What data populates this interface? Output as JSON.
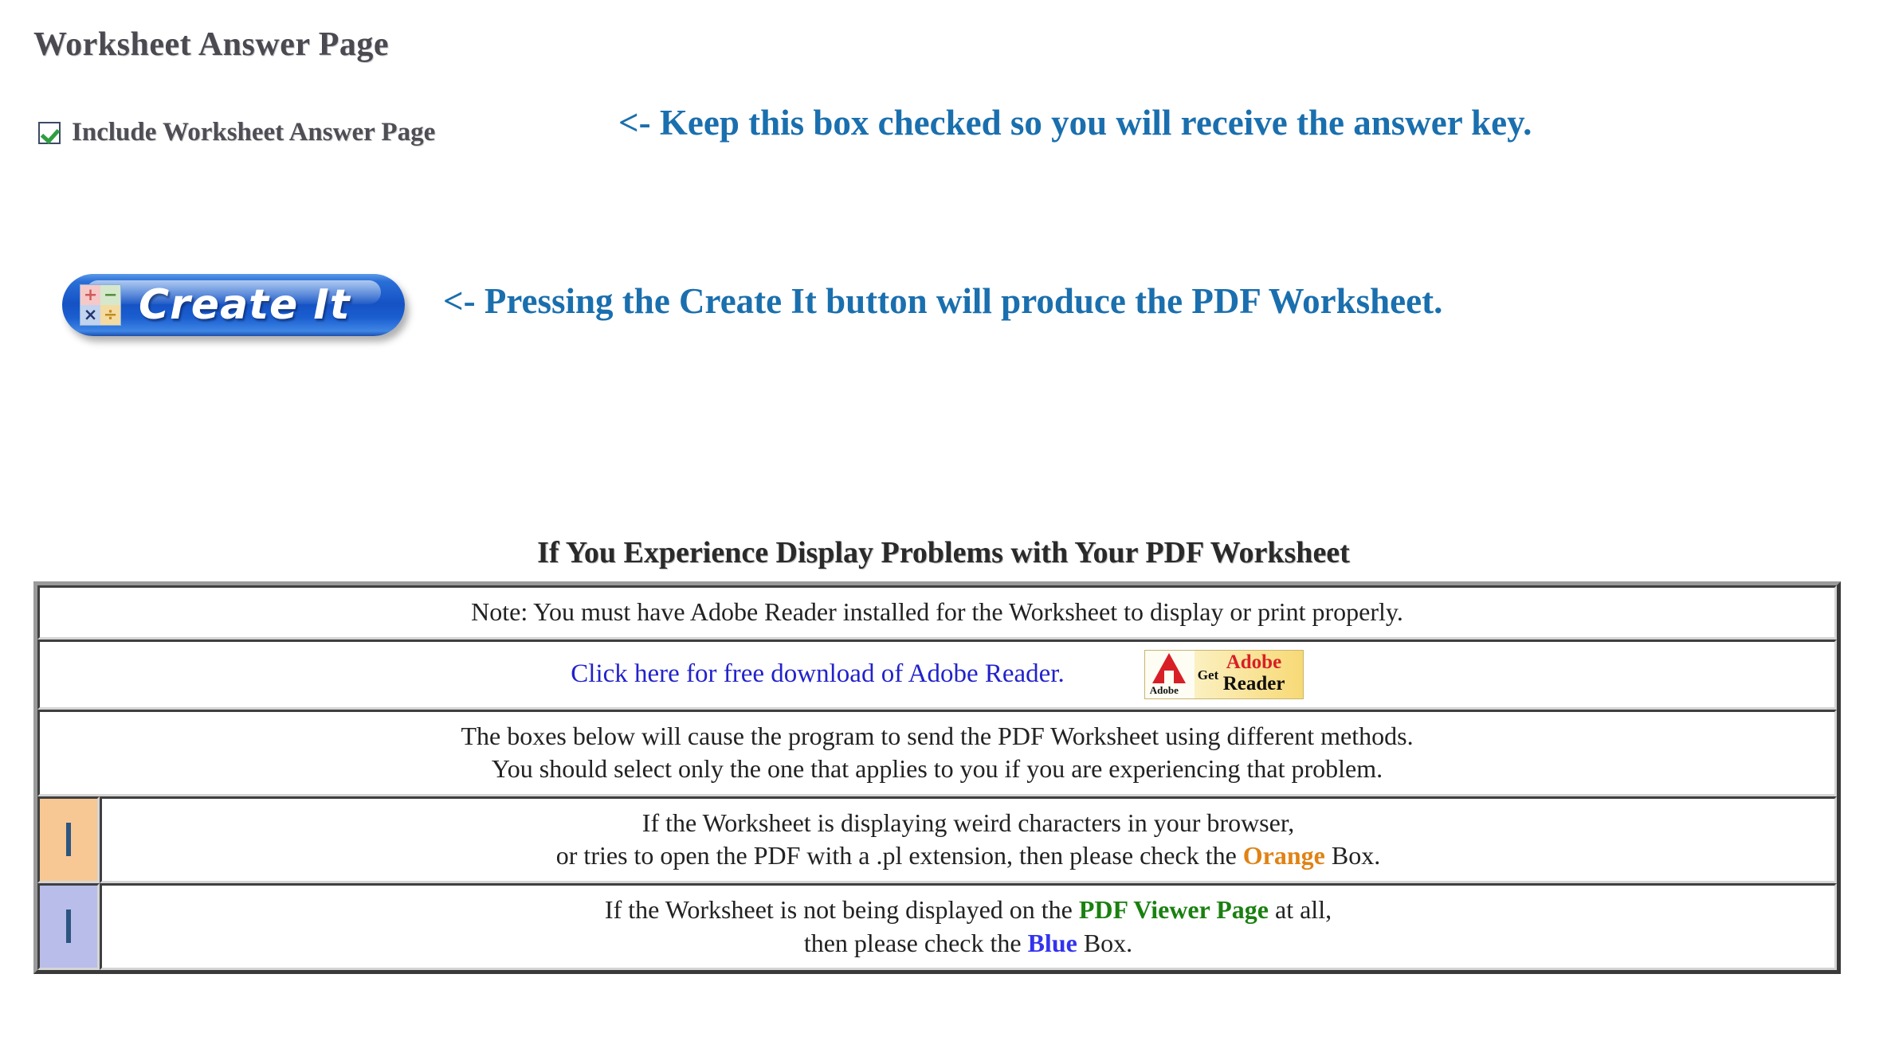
{
  "page": {
    "title": "Worksheet Answer Page"
  },
  "answer_option": {
    "label": "Include Worksheet Answer Page",
    "checked": true,
    "checkbox_icon": "checkbox-checked-icon"
  },
  "annotations": {
    "answer_note": "<- Keep this box checked so you will receive the answer key.",
    "create_note": "<- Pressing the Create It button will produce the PDF Worksheet."
  },
  "create_button": {
    "label": "Create It",
    "icon": "math-operations-icon",
    "icon_symbols": [
      "+",
      "−",
      "×",
      "÷"
    ]
  },
  "help_section": {
    "heading": "If You Experience Display Problems with Your PDF Worksheet",
    "rows": {
      "note": "Note: You must have Adobe Reader installed for the Worksheet to display or print properly.",
      "link_text": "Click here for free download of Adobe Reader.",
      "badge": {
        "get": "Get",
        "adobe": "Adobe",
        "reader": "Reader",
        "adobe_small": "Adobe",
        "icon": "adobe-reader-badge-icon"
      },
      "description_line1": "The boxes below will cause the program to send the PDF Worksheet using different methods.",
      "description_line2": "You should select only the one that applies to you if you are experiencing that problem.",
      "orange_option": {
        "line1": "If the Worksheet is displaying weird characters in your browser,",
        "line2_pre": "or tries to open the PDF with a .pl extension, then please check the ",
        "keyword": "Orange",
        "line2_post": " Box.",
        "checked": false,
        "swatch_color": "#f7c894"
      },
      "blue_option": {
        "line1_pre": "If the Worksheet is not being displayed on the ",
        "line1_keyword": "PDF Viewer Page",
        "line1_post": " at all,",
        "line2_pre": "then please check the ",
        "keyword": "Blue",
        "line2_post": " Box.",
        "checked": false,
        "swatch_color": "#b9bdea"
      }
    }
  },
  "colors": {
    "annotation_blue": "#1a6fae",
    "link_blue": "#2222cc",
    "orange_keyword": "#e08214",
    "green_keyword": "#1a8010",
    "blue_keyword": "#3333ee",
    "title_gray": "#4a4a50"
  }
}
